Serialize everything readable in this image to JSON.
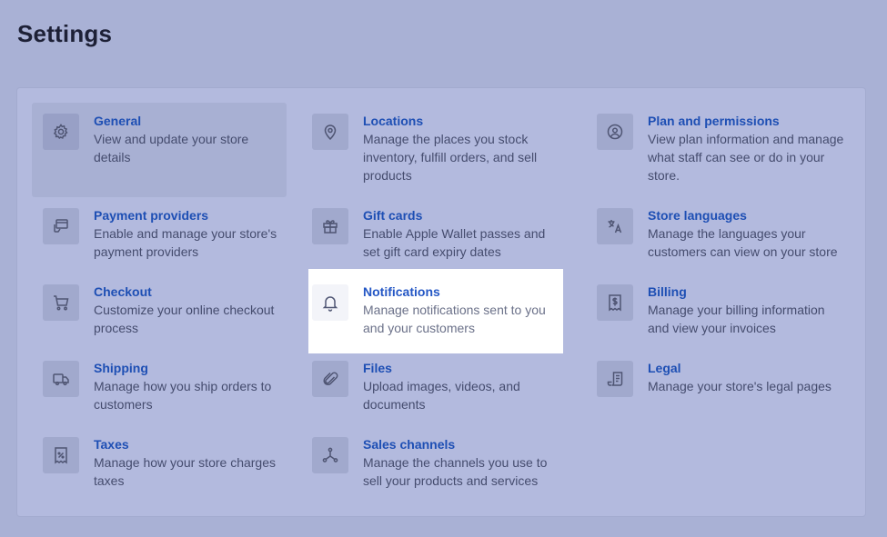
{
  "page": {
    "title": "Settings"
  },
  "settings": [
    {
      "title": "General",
      "desc": "View and update your store details",
      "icon": "gear-icon"
    },
    {
      "title": "Locations",
      "desc": "Manage the places you stock inventory, fulfill orders, and sell products",
      "icon": "location-pin-icon"
    },
    {
      "title": "Plan and permissions",
      "desc": "View plan information and manage what staff can see or do in your store.",
      "icon": "user-circle-icon"
    },
    {
      "title": "Payment providers",
      "desc": "Enable and manage your store's payment providers",
      "icon": "payment-icon"
    },
    {
      "title": "Gift cards",
      "desc": "Enable Apple Wallet passes and set gift card expiry dates",
      "icon": "gift-icon"
    },
    {
      "title": "Store languages",
      "desc": "Manage the languages your customers can view on your store",
      "icon": "translate-icon"
    },
    {
      "title": "Checkout",
      "desc": "Customize your online checkout process",
      "icon": "cart-icon"
    },
    {
      "title": "Notifications",
      "desc": "Manage notifications sent to you and your customers",
      "icon": "bell-icon"
    },
    {
      "title": "Billing",
      "desc": "Manage your billing information and view your invoices",
      "icon": "billing-icon"
    },
    {
      "title": "Shipping",
      "desc": "Manage how you ship orders to customers",
      "icon": "truck-icon"
    },
    {
      "title": "Files",
      "desc": "Upload images, videos, and documents",
      "icon": "paperclip-icon"
    },
    {
      "title": "Legal",
      "desc": "Manage your store's legal pages",
      "icon": "legal-document-icon"
    },
    {
      "title": "Taxes",
      "desc": "Manage how your store charges taxes",
      "icon": "tax-receipt-icon"
    },
    {
      "title": "Sales channels",
      "desc": "Manage the channels you use to sell your products and services",
      "icon": "channels-icon"
    }
  ]
}
